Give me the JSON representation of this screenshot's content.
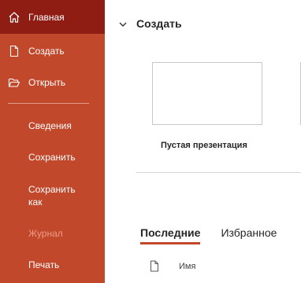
{
  "sidebar": {
    "items": [
      {
        "label": "Главная",
        "icon": "home-icon"
      },
      {
        "label": "Создать",
        "icon": "new-document-icon"
      },
      {
        "label": "Открыть",
        "icon": "open-folder-icon"
      },
      {
        "label": "Сведения"
      },
      {
        "label": "Сохранить"
      },
      {
        "label": "Сохранить как"
      },
      {
        "label": "Журнал"
      },
      {
        "label": "Печать"
      }
    ]
  },
  "main": {
    "section_title": "Создать",
    "template_caption": "Пустая презентация",
    "tabs": [
      {
        "label": "Последние"
      },
      {
        "label": "Избранное"
      }
    ],
    "column_name": "Имя"
  },
  "colors": {
    "sidebar_bg": "#c2482b",
    "sidebar_active": "#8f1d13",
    "accent": "#c2482b"
  }
}
